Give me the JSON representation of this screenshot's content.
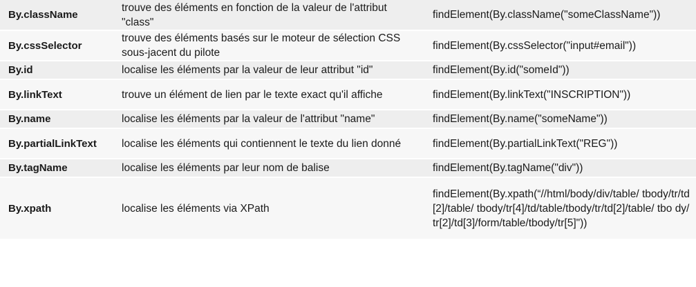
{
  "rows": [
    {
      "locator": "By.className",
      "description": "trouve des éléments en fonction de la valeur de l'attribut \"class\"",
      "example": "findElement(By.className(\"someClassName\"))"
    },
    {
      "locator": "By.cssSelector",
      "description": "trouve des éléments basés sur le moteur de sélection CSS sous-jacent du pilote",
      "example": "findElement(By.cssSelector(\"input#email\"))"
    },
    {
      "locator": "By.id",
      "description": "localise les éléments par la valeur de leur attribut \"id\"",
      "example": "findElement(By.id(\"someId\"))"
    },
    {
      "locator": "By.linkText",
      "description": "trouve un élément de lien par le texte exact qu'il affiche",
      "example": "findElement(By.linkText(\"INSCRIPTION\"))"
    },
    {
      "locator": "By.name",
      "description": "localise les éléments par la valeur de l'attribut \"name\"",
      "example": "findElement(By.name(\"someName\"))"
    },
    {
      "locator": "By.partialLinkText",
      "description": "localise les éléments qui contiennent le texte du lien donné",
      "example": "findElement(By.partialLinkText(\"REG\"))"
    },
    {
      "locator": "By.tagName",
      "description": "localise les éléments par leur nom de balise",
      "example": "findElement(By.tagName(\"div\"))"
    },
    {
      "locator": "By.xpath",
      "description": "localise les éléments via XPath",
      "example": "findElement(By.xpath(“//html/body/div/table/ tbody/tr/td[2]/table/ tbody/tr[4]/td/table/tbody/tr/td[2]/table/ tbo dy/tr[2]/td[3]/form/table/tbody/tr[5]\"))"
    }
  ]
}
